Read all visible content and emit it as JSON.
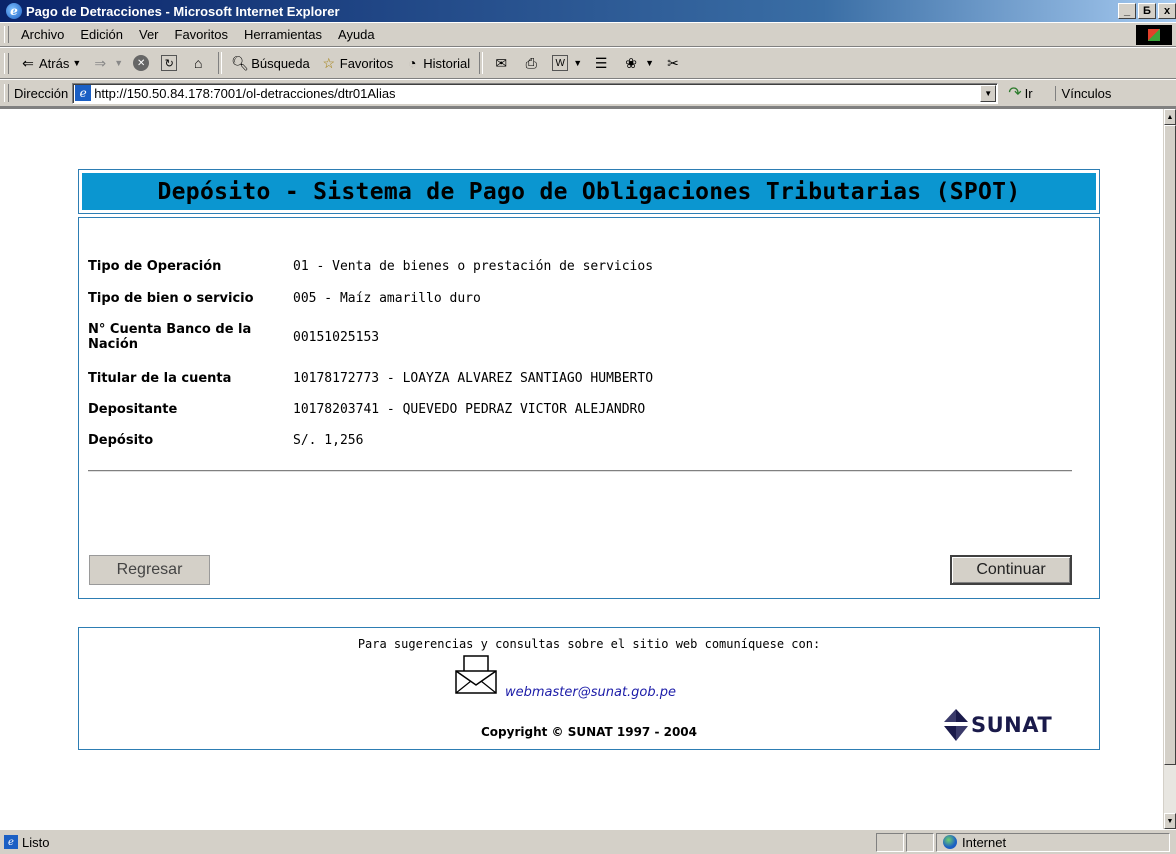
{
  "window": {
    "title": "Pago de Detracciones - Microsoft Internet Explorer",
    "buttons": [
      "_",
      "Б",
      "x"
    ]
  },
  "menubar": {
    "items": [
      "Archivo",
      "Edición",
      "Ver",
      "Favoritos",
      "Herramientas",
      "Ayuda"
    ]
  },
  "toolbar": {
    "back_label": "Atrás",
    "search_label": "Búsqueda",
    "favorites_label": "Favoritos",
    "history_label": "Historial"
  },
  "addressbar": {
    "label": "Dirección",
    "url": "http://150.50.84.178:7001/ol-detracciones/dtr01Alias",
    "go_label": "Ir",
    "links_label": "Vínculos"
  },
  "page": {
    "header_title": "Depósito - Sistema de Pago de Obligaciones Tributarias (SPOT)",
    "fields": [
      {
        "label": "Tipo de Operación",
        "value": "01 - Venta de bienes o prestación de servicios"
      },
      {
        "label": "Tipo de bien o servicio",
        "value": "005 - Maíz amarillo duro"
      },
      {
        "label": "N° Cuenta Banco de la Nación",
        "value": "00151025153"
      },
      {
        "label": "Titular de la cuenta",
        "value": "10178172773 - LOAYZA ALVAREZ SANTIAGO HUMBERTO"
      },
      {
        "label": "Depositante",
        "value": "10178203741 - QUEVEDO PEDRAZ VICTOR ALEJANDRO"
      },
      {
        "label": "Depósito",
        "value": "S/. 1,256"
      }
    ],
    "back_button": "Regresar",
    "continue_button": "Continuar"
  },
  "footer": {
    "note": "Para sugerencias y consultas sobre el sitio web comuníquese con:",
    "email": "webmaster@sunat.gob.pe",
    "copyright": "Copyright © SUNAT 1997 - 2004",
    "logo_text": "SUNAT"
  },
  "statusbar": {
    "status": "Listo",
    "zone": "Internet"
  },
  "colors": {
    "header_band": "#0b96d0",
    "panel_border": "#2d7db3",
    "titlebar": "#0a246a",
    "link": "#1c1ca8"
  }
}
